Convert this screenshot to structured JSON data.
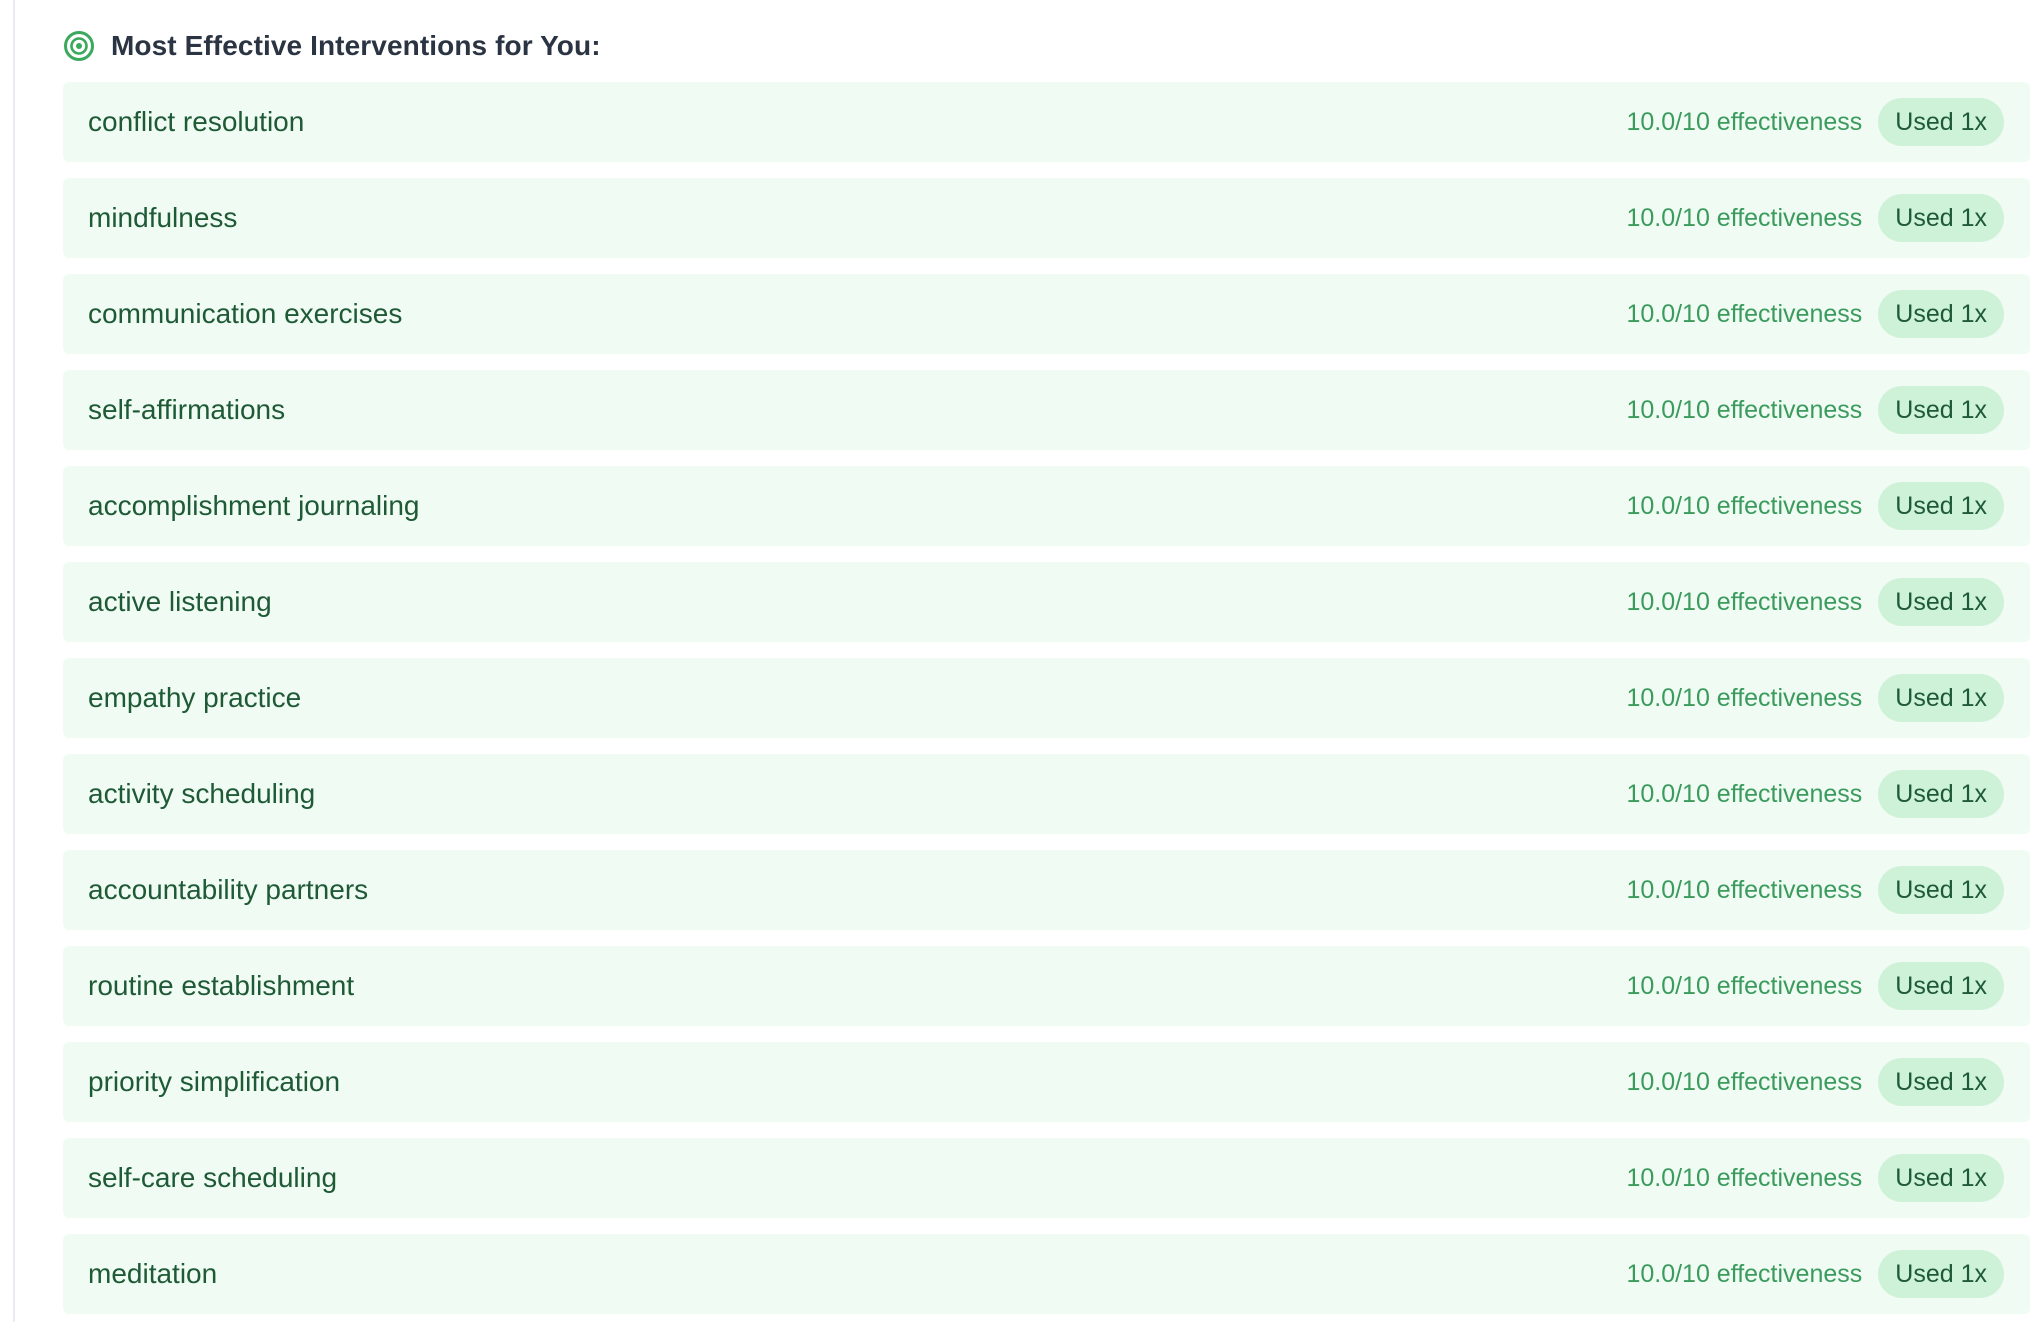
{
  "section": {
    "icon": "target-icon",
    "title": "Most Effective Interventions for You:"
  },
  "colors": {
    "row_background": "#f0fbf3",
    "row_text": "#1e5a36",
    "score_text": "#3a9b5c",
    "badge_background": "#cdf2d8",
    "icon": "#3aa85d"
  },
  "interventions": [
    {
      "name": "conflict resolution",
      "score": "10.0/10 effectiveness",
      "usage": "Used 1x"
    },
    {
      "name": "mindfulness",
      "score": "10.0/10 effectiveness",
      "usage": "Used 1x"
    },
    {
      "name": "communication exercises",
      "score": "10.0/10 effectiveness",
      "usage": "Used 1x"
    },
    {
      "name": "self-affirmations",
      "score": "10.0/10 effectiveness",
      "usage": "Used 1x"
    },
    {
      "name": "accomplishment journaling",
      "score": "10.0/10 effectiveness",
      "usage": "Used 1x"
    },
    {
      "name": "active listening",
      "score": "10.0/10 effectiveness",
      "usage": "Used 1x"
    },
    {
      "name": "empathy practice",
      "score": "10.0/10 effectiveness",
      "usage": "Used 1x"
    },
    {
      "name": "activity scheduling",
      "score": "10.0/10 effectiveness",
      "usage": "Used 1x"
    },
    {
      "name": "accountability partners",
      "score": "10.0/10 effectiveness",
      "usage": "Used 1x"
    },
    {
      "name": "routine establishment",
      "score": "10.0/10 effectiveness",
      "usage": "Used 1x"
    },
    {
      "name": "priority simplification",
      "score": "10.0/10 effectiveness",
      "usage": "Used 1x"
    },
    {
      "name": "self-care scheduling",
      "score": "10.0/10 effectiveness",
      "usage": "Used 1x"
    },
    {
      "name": "meditation",
      "score": "10.0/10 effectiveness",
      "usage": "Used 1x"
    }
  ]
}
